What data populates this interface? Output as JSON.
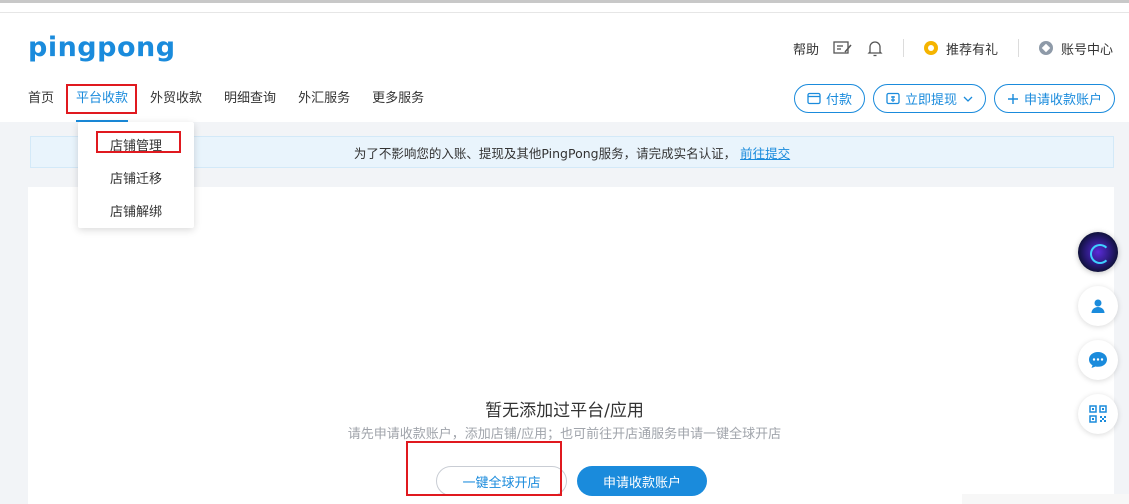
{
  "header": {
    "logo": "pingpong",
    "help": "帮助",
    "refer": "推荐有礼",
    "account": "账号中心"
  },
  "nav": {
    "items": [
      "首页",
      "平台收款",
      "外贸收款",
      "明细查询",
      "外汇服务",
      "更多服务"
    ]
  },
  "actions": {
    "pay": "付款",
    "withdraw": "立即提现",
    "apply": "申请收款账户"
  },
  "dropdown": {
    "items": [
      "店铺管理",
      "店铺迁移",
      "店铺解绑"
    ]
  },
  "notice": {
    "text": "为了不影响您的入账、提现及其他PingPong服务，请完成实名认证，",
    "link": "前往提交"
  },
  "empty": {
    "title": "暂无添加过平台/应用",
    "subtitle": "请先申请收款账户，添加店铺/应用；也可前往开店通服务申请一键全球开店",
    "btn_global": "一键全球开店",
    "btn_apply": "申请收款账户"
  },
  "colors": {
    "brand": "#1a8bdc",
    "highlight": "#e0191f"
  }
}
